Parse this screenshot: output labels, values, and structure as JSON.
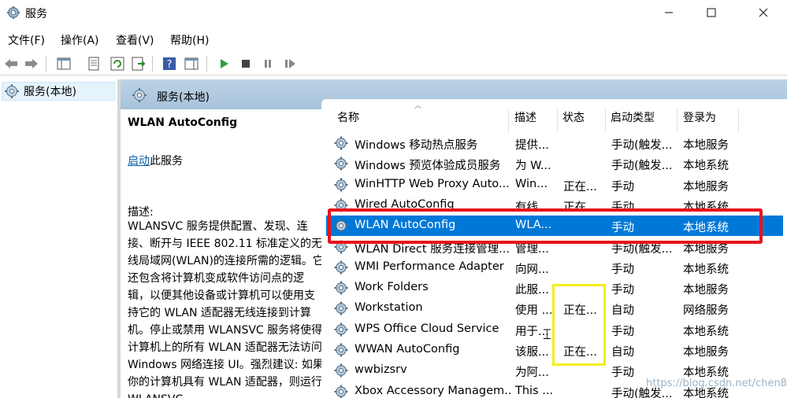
{
  "window": {
    "title": "服务"
  },
  "menu": [
    "文件(F)",
    "操作(A)",
    "查看(V)",
    "帮助(H)"
  ],
  "tree": {
    "root": "服务(本地)"
  },
  "header": {
    "title": "服务(本地)"
  },
  "detail": {
    "service_name": "WLAN AutoConfig",
    "start_link": "启动",
    "start_suffix": "此服务",
    "desc_label": "描述:",
    "desc_text": "WLANSVC 服务提供配置、发现、连接、断开与 IEEE 802.11 标准定义的无线局域网(WLAN)的连接所需的逻辑。它还包含将计算机变成软件访问点的逻辑，以便其他设备或计算机可以使用支持它的 WLAN 适配器无线连接到计算机。停止或禁用 WLANSVC 服务将使得计算机上的所有 WLAN 适配器无法访问 Windows 网络连接 UI。强烈建议: 如果你的计算机具有 WLAN 适配器，则运行 WLANSVC"
  },
  "columns": {
    "name": "名称",
    "desc": "描述",
    "status": "状态",
    "startup": "启动类型",
    "logon": "登录为"
  },
  "rows": [
    {
      "name": "Windows 移动热点服务",
      "desc": "提供...",
      "status": "",
      "startup": "手动(触发...",
      "logon": "本地服务"
    },
    {
      "name": "Windows 预览体验成员服务",
      "desc": "为 W...",
      "status": "",
      "startup": "手动(触发...",
      "logon": "本地系统"
    },
    {
      "name": "WinHTTP Web Proxy Auto...",
      "desc": "Win...",
      "status": "正在...",
      "startup": "手动",
      "logon": "本地服务"
    },
    {
      "name": "Wired AutoConfig",
      "desc": "有线...",
      "status": "正在...",
      "startup": "手动",
      "logon": "本地系统"
    },
    {
      "name": "WLAN AutoConfig",
      "desc": "WLA...",
      "status": "",
      "startup": "手动",
      "logon": "本地系统"
    },
    {
      "name": "WLAN Direct 服务连接管理...",
      "desc": "管理...",
      "status": "",
      "startup": "手动(触发...",
      "logon": "本地服务"
    },
    {
      "name": "WMI Performance Adapter",
      "desc": "向网...",
      "status": "",
      "startup": "手动",
      "logon": "本地系统"
    },
    {
      "name": "Work Folders",
      "desc": "此服...",
      "status": "",
      "startup": "手动",
      "logon": "本地服务"
    },
    {
      "name": "Workstation",
      "desc": "使用 ...",
      "status": "正在...",
      "startup": "自动",
      "logon": "网络服务"
    },
    {
      "name": "WPS Office Cloud Service",
      "desc": "用于...",
      "status": "",
      "startup": "手动",
      "logon": "本地系统"
    },
    {
      "name": "WWAN AutoConfig",
      "desc": "该服...",
      "status": "正在...",
      "startup": "自动",
      "logon": "本地服务"
    },
    {
      "name": "wwbizsrv",
      "desc": "为阿...",
      "status": "",
      "startup": "手动",
      "logon": "本地系统"
    },
    {
      "name": "Xbox Accessory Managem...",
      "desc": "This ...",
      "status": "",
      "startup": "手动(触发...",
      "logon": "本地系统"
    }
  ],
  "selected_row": 4,
  "watermark": "https://blog.csdn.net/chen820",
  "colors": {
    "selection": "#0078d7",
    "highlight_red": "#e8141b",
    "highlight_yellow": "#f3ee18"
  }
}
